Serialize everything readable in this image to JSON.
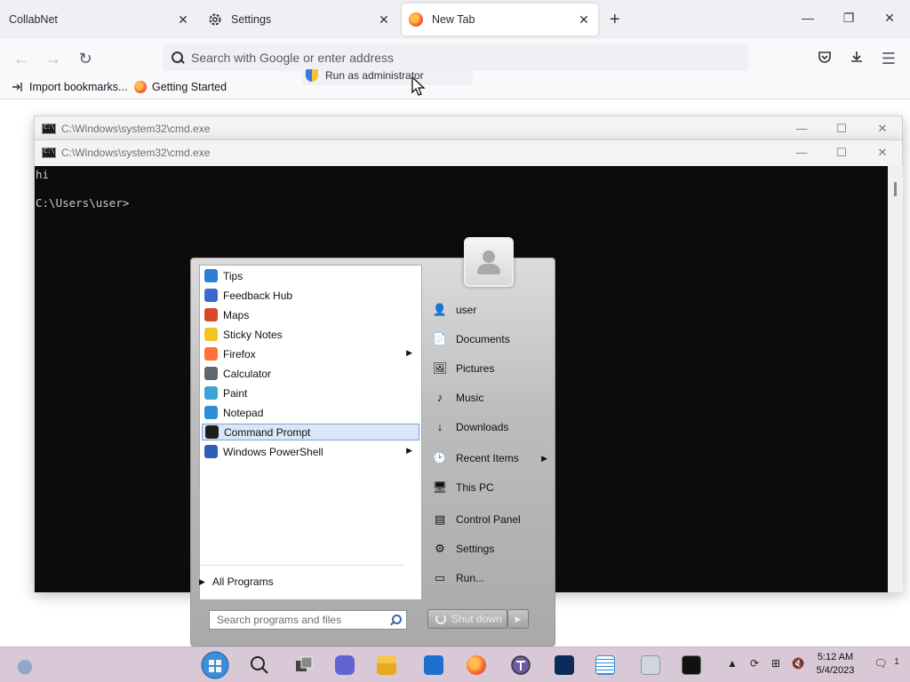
{
  "browser": {
    "tabs": [
      {
        "label": "CollabNet"
      },
      {
        "label": "Settings"
      },
      {
        "label": "New Tab"
      }
    ],
    "urlbar": {
      "placeholder": "Search with Google or enter address"
    },
    "bookmarks": [
      {
        "label": "Import bookmarks..."
      },
      {
        "label": "Getting Started"
      }
    ],
    "tooltip": {
      "label": "Run as administrator"
    }
  },
  "cmd_windows": {
    "back_title": "C:\\Windows\\system32\\cmd.exe",
    "front_title": "C:\\Windows\\system32\\cmd.exe",
    "output_lines": [
      "hi",
      "",
      "C:\\Users\\user>"
    ]
  },
  "start_menu": {
    "programs": [
      {
        "label": "Tips",
        "icon": "tips-icon",
        "color": "#2b7fd4"
      },
      {
        "label": "Feedback Hub",
        "icon": "feedback-hub-icon",
        "color": "#3a6ad1"
      },
      {
        "label": "Maps",
        "icon": "maps-icon",
        "color": "#d9472a"
      },
      {
        "label": "Sticky Notes",
        "icon": "sticky-notes-icon",
        "color": "#f3c322"
      },
      {
        "label": "Firefox",
        "icon": "firefox-icon",
        "color": "#ff7139",
        "submenu": true
      },
      {
        "label": "Calculator",
        "icon": "calculator-icon",
        "color": "#5c6770"
      },
      {
        "label": "Paint",
        "icon": "paint-icon",
        "color": "#3fa3d8"
      },
      {
        "label": "Notepad",
        "icon": "notepad-icon",
        "color": "#2e8ed6"
      },
      {
        "label": "Command Prompt",
        "icon": "command-prompt-icon",
        "color": "#1e1e1e",
        "selected": true
      },
      {
        "label": "Windows PowerShell",
        "icon": "powershell-icon",
        "color": "#2f5fb3",
        "submenu": true
      }
    ],
    "all_programs": "All Programs",
    "search_placeholder": "Search programs and files",
    "places": [
      {
        "label": "user",
        "icon": "user-folder-icon"
      },
      {
        "label": "Documents",
        "icon": "documents-icon"
      },
      {
        "label": "Pictures",
        "icon": "pictures-icon"
      },
      {
        "label": "Music",
        "icon": "music-icon"
      },
      {
        "label": "Downloads",
        "icon": "downloads-icon"
      },
      {
        "label": "Recent Items",
        "icon": "recent-items-icon",
        "submenu": true
      },
      {
        "label": "This PC",
        "icon": "this-pc-icon"
      },
      {
        "label": "Control Panel",
        "icon": "control-panel-icon"
      },
      {
        "label": "Settings",
        "icon": "settings-icon"
      },
      {
        "label": "Run...",
        "icon": "run-icon"
      }
    ],
    "shutdown_label": "Shut down"
  },
  "taskbar": {
    "clock_time": "5:12 AM",
    "clock_date": "5/4/2023",
    "notification_count": "1"
  }
}
